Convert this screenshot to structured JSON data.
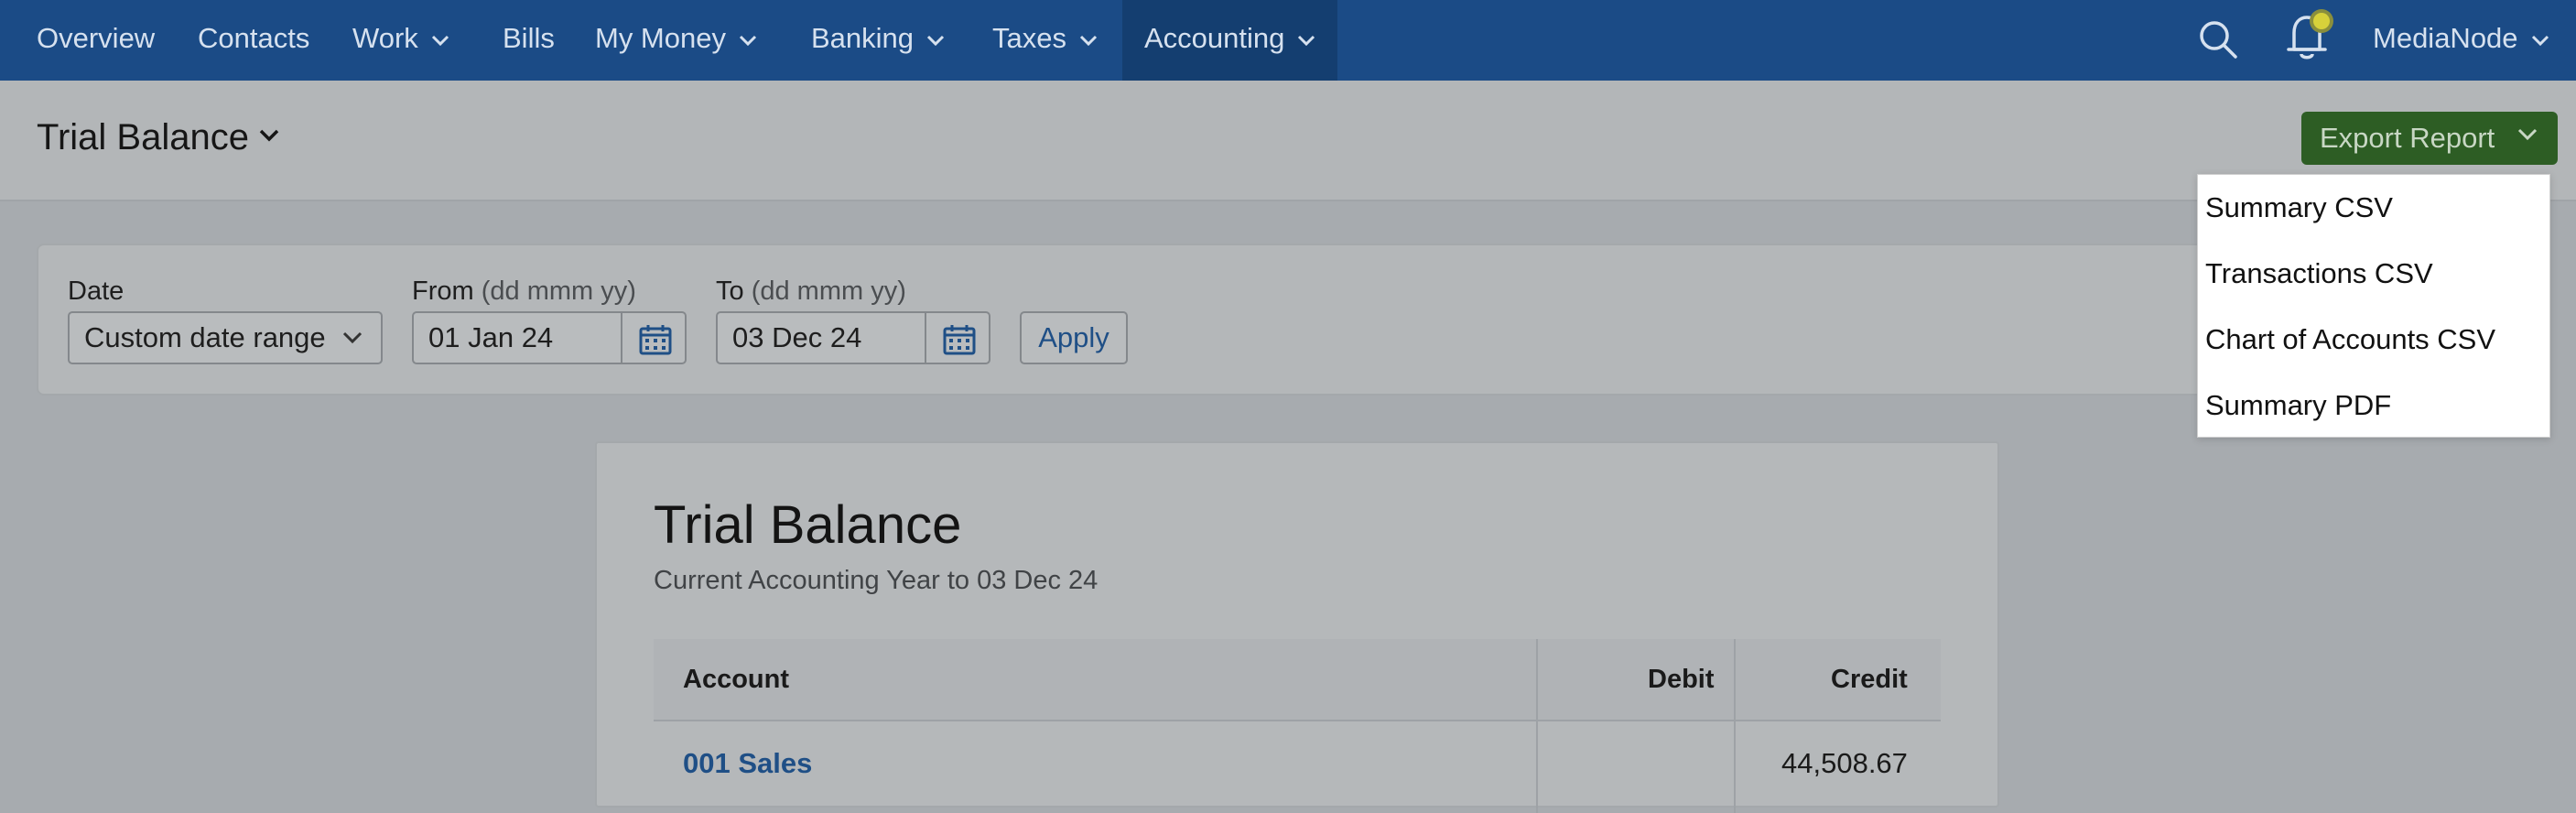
{
  "nav": {
    "items": [
      {
        "label": "Overview",
        "chevron": false
      },
      {
        "label": "Contacts",
        "chevron": false
      },
      {
        "label": "Work",
        "chevron": true
      },
      {
        "label": "Bills",
        "chevron": false
      },
      {
        "label": "My Money",
        "chevron": true
      },
      {
        "label": "Banking",
        "chevron": true
      },
      {
        "label": "Taxes",
        "chevron": true
      },
      {
        "label": "Accounting",
        "chevron": true,
        "active": true
      }
    ],
    "user": "MediaNode",
    "icons": {
      "search": "search-icon",
      "notifications": "bell-icon"
    }
  },
  "header": {
    "title": "Trial Balance",
    "export_label": "Export Report"
  },
  "export_menu": {
    "items": [
      "Summary CSV",
      "Transactions CSV",
      "Chart of Accounts CSV",
      "Summary PDF"
    ]
  },
  "filters": {
    "date_label": "Date",
    "date_range_value": "Custom date range",
    "from_label": "From",
    "from_hint": "(dd mmm yy)",
    "from_value": "01 Jan 24",
    "to_label": "To",
    "to_hint": "(dd mmm yy)",
    "to_value": "03 Dec 24",
    "apply_label": "Apply"
  },
  "report": {
    "title": "Trial Balance",
    "subtitle": "Current Accounting Year to 03 Dec 24",
    "columns": {
      "account": "Account",
      "debit": "Debit",
      "credit": "Credit"
    },
    "rows": [
      {
        "account": "001 Sales",
        "debit": "",
        "credit": "44,508.67"
      }
    ]
  },
  "colors": {
    "nav_bg": "#1b4b86",
    "nav_active_bg": "#143e70",
    "export_bg": "#2d5d24",
    "link": "#1f4f86",
    "notification_dot": "#d7d13a"
  }
}
